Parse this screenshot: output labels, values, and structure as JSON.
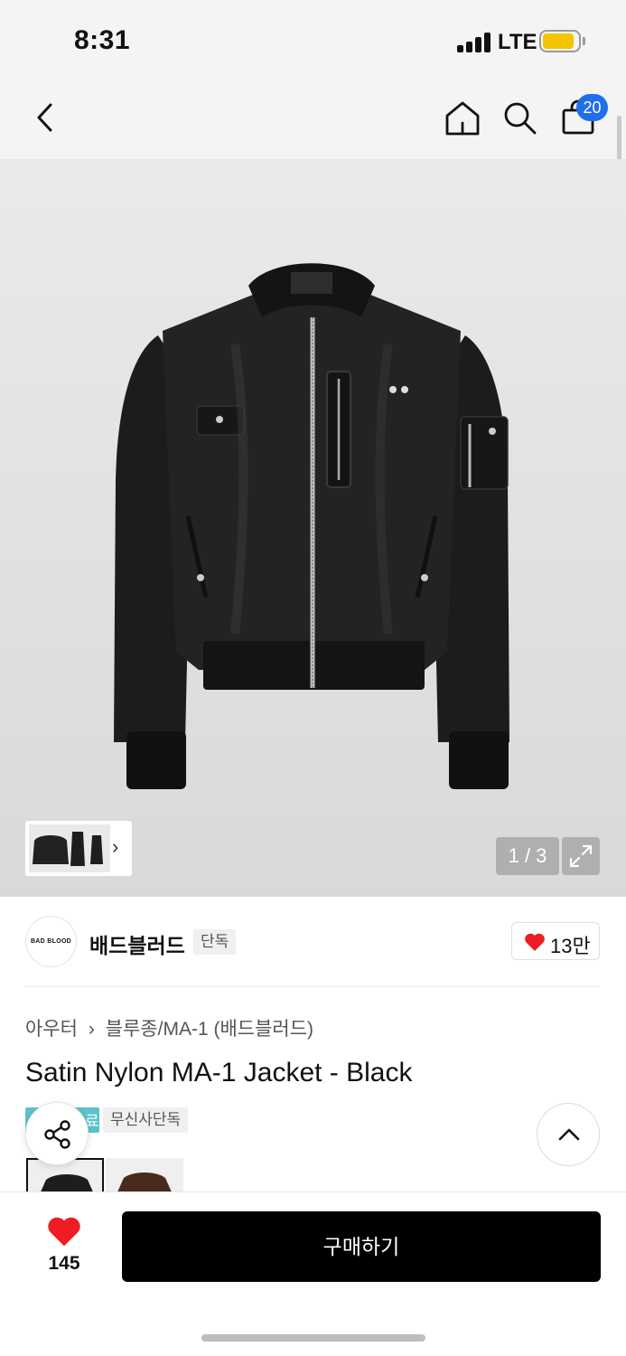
{
  "status_bar": {
    "time": "8:31",
    "network": "LTE",
    "battery_level": 0.9,
    "battery_color": "#f5c400"
  },
  "header": {
    "back_icon": "chevron-left-icon",
    "home_icon": "home-icon",
    "search_icon": "search-icon",
    "cart_icon": "shopping-bag-icon",
    "cart_count": "20",
    "badge_color": "#1f6fe8"
  },
  "gallery": {
    "page_counter": "1 / 3",
    "current_page": 1,
    "total_pages": 3,
    "thumbnail_arrow": "›",
    "expand_icon": "expand-icon"
  },
  "brand": {
    "logo_text": "BAD BLOOD",
    "name": "배드블러드",
    "tag": "단독",
    "likes": "13만",
    "heart_color": "#ee1c25"
  },
  "product": {
    "breadcrumb": [
      "아우터",
      "›",
      "블루종/MA-1 (배드블러드)"
    ],
    "title": "Satin Nylon MA-1 Jacket - Black",
    "badge_teal_text": "료",
    "badge_teal_color": "#5cc2cc",
    "badge_exclusive": "무신사단독",
    "color_options": [
      "black",
      "brown"
    ]
  },
  "actions": {
    "share_icon": "share-icon",
    "scroll_top_icon": "chevron-up-icon"
  },
  "bottom_bar": {
    "wish_count": "145",
    "buy_label": "구매하기"
  }
}
